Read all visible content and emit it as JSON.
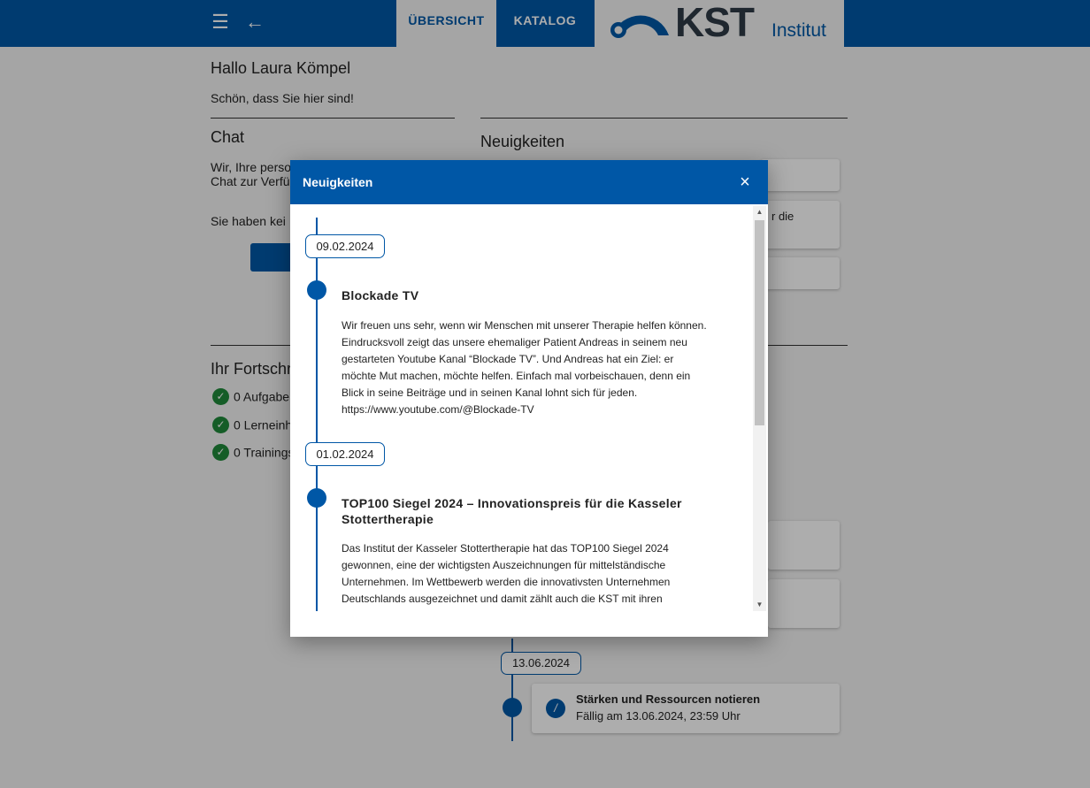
{
  "topbar": {
    "tabs": [
      {
        "label": "ÜBERSICHT"
      },
      {
        "label": "KATALOG"
      }
    ],
    "logo": {
      "kst": "KST",
      "institut": "Institut"
    }
  },
  "home": {
    "greeting": "Hallo Laura Kömpel",
    "welcome": "Schön, dass Sie hier sind!",
    "chat": {
      "title": "Chat",
      "line1": "Wir, Ihre perso",
      "line2": "Chat zur Verfü",
      "no_messages": "Sie haben kei"
    },
    "news_title": "Neuigkeiten",
    "news_card_fragment": "r die",
    "progress": {
      "title": "Ihr Fortschr",
      "items": [
        "0 Aufgabe",
        "0 Lerneinh",
        "0 Trainings"
      ]
    },
    "timeline": {
      "date": "13.06.2024",
      "task_title": "Stärken und Ressourcen notieren",
      "task_due": "Fällig am 13.06.2024, 23:59 Uhr"
    }
  },
  "modal": {
    "title": "Neuigkeiten",
    "close": "×",
    "entries": [
      {
        "date": "09.02.2024",
        "title": "Blockade TV",
        "lines": [
          "Wir freuen uns sehr, wenn wir Menschen mit unserer Therapie helfen können.",
          "Eindrucksvoll zeigt das unsere ehemaliger Patient Andreas in seinem neu",
          "gestarteten Youtube Kanal “Blockade TV”. Und Andreas hat ein Ziel: er",
          "möchte Mut machen, möchte helfen. Einfach mal vorbeischauen, denn ein",
          "Blick in seine Beiträge und in seinen Kanal lohnt sich für jeden.",
          "https://www.youtube.com/@Blockade-TV"
        ]
      },
      {
        "date": "01.02.2024",
        "title_line1": "TOP100 Siegel 2024 – Innovationspreis für die Kasseler",
        "title_line2": "Stottertherapie",
        "lines": [
          "Das Institut der Kasseler Stottertherapie hat das TOP100 Siegel 2024",
          "gewonnen, eine der wichtigsten Auszeichnungen für mittelständische",
          "Unternehmen. Im Wettbewerb werden die innovativsten Unternehmen",
          "Deutschlands ausgezeichnet und damit zählt auch die KST mit ihren"
        ]
      }
    ]
  },
  "colors": {
    "brand": "#0057a6",
    "success": "#1f8a3a"
  }
}
